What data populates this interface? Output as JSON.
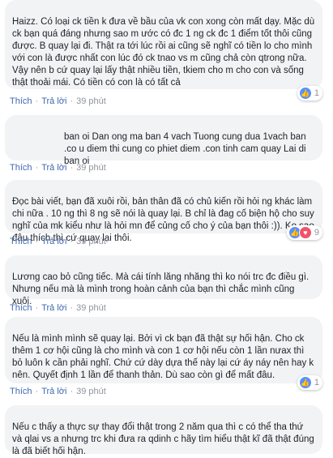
{
  "comments": [
    {
      "text": "Haizz. Có loại ck tiền k đưa về bầu của vk con xong còn mất dạy. Mặc dù ck bạn quá đáng nhưng sao m ước có đc 1 ng ck đc 1 điểm tốt thôi cũng được. B quay lại đi. Thật ra tới lúc rồi ai cũng sẽ nghĩ có tiền lo cho mình với con là được nhất con lúc đó ck tnao vs m cũng chả còn qtrong nữa. Vậy nên b cứ quay lại lấy thật nhiều tiền, tkiem cho m cho con và sống thật thoải mái. Có tiền có con là có tất cả",
      "like": "Thích",
      "reply": "Trả lời",
      "time": "39 phút",
      "reaction_count": "1"
    },
    {
      "text": "ban oi Dan ong ma ban 4 vach Tuong cung dua 1vach ban .co u diem thi cung co phiet diem .con tinh cam quay Lai di ban oi",
      "like": "Thích",
      "reply": "Trả lời",
      "time": "39 phút"
    },
    {
      "text": "Đọc bài viết, bạn đã xuôi rồi, bản thân đã có chủ kiến rồi hỏi ng khác làm chi nữa . 10 ng thì 8 ng sẽ nói là quay lại. B chỉ là đag cố biện hộ cho suy nghĩ của mk kiểu như là hỏi mn để củng cố cho ý của bạn thôi :)). Ko sao đâu thích thì cứ quay lại thôi.",
      "like": "Thích",
      "reply": "Trả lời",
      "time": "39 phút",
      "reaction_count": "9"
    },
    {
      "text": "Lương cao bỏ cũng tiếc. Mà cái tính lăng nhăng thì ko nói trc đc điều gì. Nhưng nếu mà là mình trong hoàn cảnh của bạn thì chắc mình cũng xuôi.",
      "like": "Thích",
      "reply": "Trả lời",
      "time": "39 phút"
    },
    {
      "text": "Nếu là mình mình sẽ quay lại. Bởi vì ck bạn đã thật sự hối hận. Cho ck thêm 1 cơ hội cũng là cho mình và con 1 cơ hội nếu còn 1 lần nưax thì bỏ luôn k cần phải nghĩ. Chứ cứ dày dựa thế này lại cứ áy náy nên hay k nên. Quyết định 1 lần để thanh thản. Dù sao còn gì để mất đâu.",
      "like": "Thích",
      "reply": "Trả lời",
      "time": "39 phút",
      "reaction_count": "1"
    },
    {
      "text": "Nếu c thấy a thực sự thay đổi thật trong 2 năm qua thì c có thể tha thứ và qlai vs a nhưng trc khi đưa ra qdinh c hãy tìm hiểu thật kĩ đã thật đúng là đã biết hối hận.",
      "like": "Thích",
      "reply": "Trả lời",
      "time": "39 phút"
    }
  ],
  "icons": {
    "like": "thumbs-up-icon",
    "love": "heart-icon"
  },
  "colors": {
    "bubble": "#f2f3f5",
    "link": "#4267b2",
    "meta": "#90949c",
    "like_blue": "#5890ff",
    "love_red": "#f25268"
  }
}
